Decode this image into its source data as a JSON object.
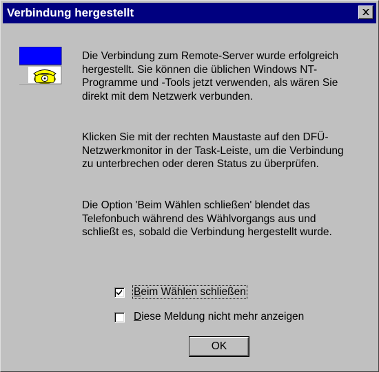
{
  "window": {
    "title": "Verbindung hergestellt",
    "close_symbol": "close-icon"
  },
  "icon": {
    "name": "phone-connection-icon",
    "colors": {
      "screen": "#0000ff",
      "phone": "#ffff00"
    }
  },
  "message": {
    "paragraph1": "Die Verbindung zum Remote-Server wurde erfolgreich hergestellt. Sie können die üblichen Windows NT-Programme und -Tools jetzt verwenden, als wären Sie direkt mit dem Netzwerk verbunden.",
    "paragraph2": "Klicken Sie mit der rechten Maustaste auf den DFÜ-Netzwerkmonitor in der Task-Leiste, um die Verbindung zu unterbrechen oder deren Status zu überprüfen.",
    "paragraph3": "Die Option 'Beim Wählen schließen' blendet das Telefonbuch während des Wählvorgangs aus und schließt es, sobald die Verbindung hergestellt wurde."
  },
  "options": {
    "close_on_dial": {
      "label_first": "B",
      "label_rest": "eim Wählen schließen",
      "checked": true
    },
    "dont_show_again": {
      "label_first": "D",
      "label_rest": "iese Meldung nicht mehr anzeigen",
      "checked": false
    }
  },
  "buttons": {
    "ok_label": "OK"
  },
  "colors": {
    "titlebar": "#000080",
    "dialog_face": "#c0c0c0"
  }
}
